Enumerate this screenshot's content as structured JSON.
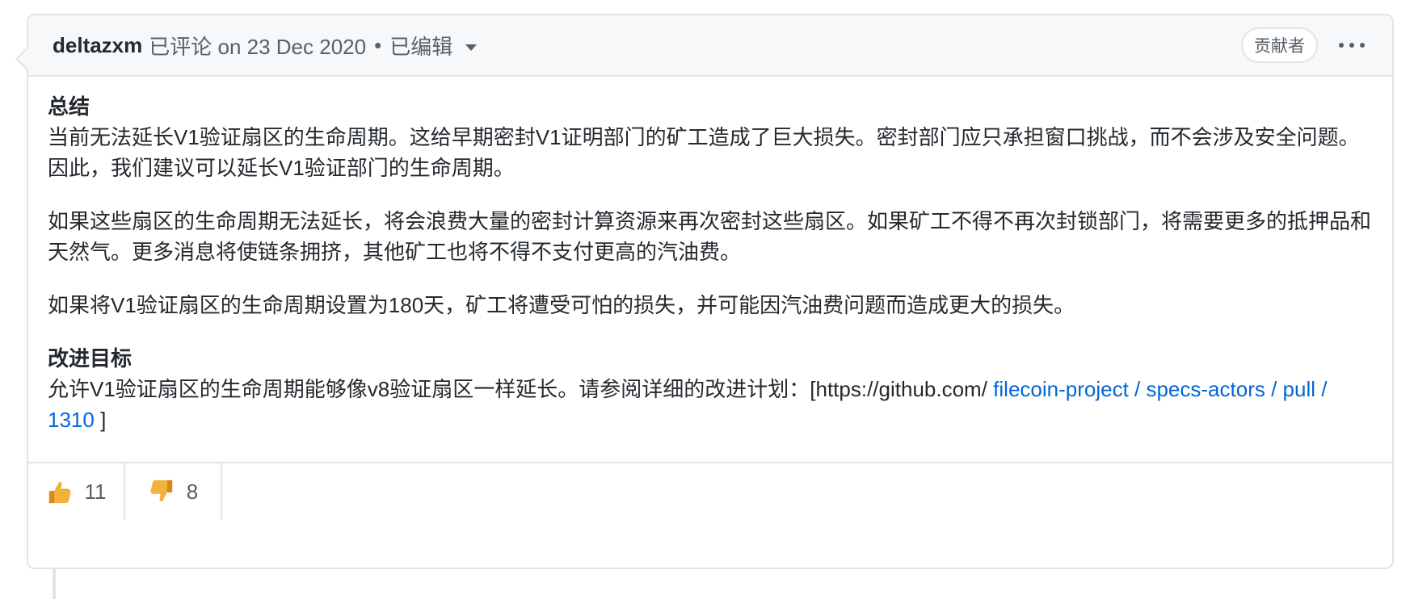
{
  "comment": {
    "author": "deltazxm",
    "action": "已评论 on 23 Dec 2020",
    "separator": "•",
    "edited": "已编辑",
    "badge": "贡献者",
    "more_icon": "kebab-horizontal-icon",
    "body": {
      "heading1": "总结",
      "p1": "当前无法延长V1验证扇区的生命周期。这给早期密封V1证明部门的矿工造成了巨大损失。密封部门应只承担窗口挑战，而不会涉及安全问题。因此，我们建议可以延长V1验证部门的生命周期。",
      "p2": "如果这些扇区的生命周期无法延长，将会浪费大量的密封计算资源来再次密封这些扇区。如果矿工不得不再次封锁部门，将需要更多的抵押品和天然气。更多消息将使链条拥挤，其他矿工也将不得不支付更高的汽油费。",
      "p3": "如果将V1验证扇区的生命周期设置为180天，矿工将遭受可怕的损失，并可能因汽油费问题而造成更大的损失。",
      "heading2": "改进目标",
      "p4_text": "允许V1验证扇区的生命周期能够像v8验证扇区一样延长。请参阅详细的改进计划：[https://github.com/",
      "p4_link": "filecoin-project / specs-actors / pull / 1310",
      "p4_end": "]"
    },
    "reactions": [
      {
        "icon": "thumbs-up-icon",
        "count": "11"
      },
      {
        "icon": "thumbs-down-icon",
        "count": "8"
      }
    ]
  },
  "colors": {
    "link": "#0366d6",
    "border": "#e1e4e8",
    "header_bg": "#f6f8fa",
    "muted_text": "#586069"
  }
}
